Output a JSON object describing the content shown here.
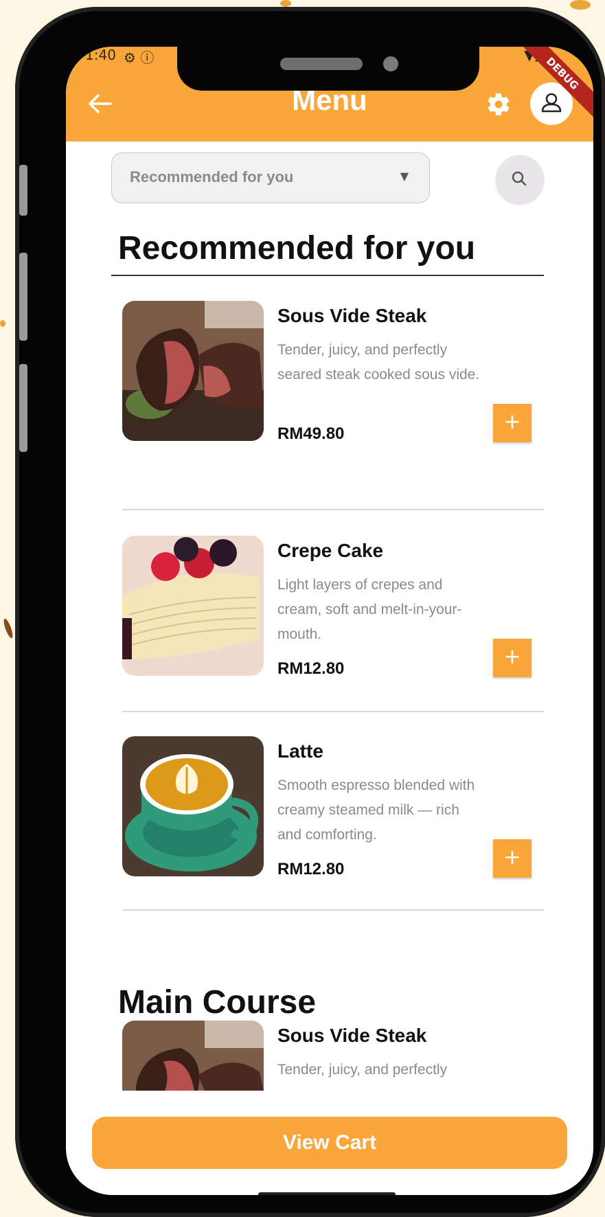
{
  "status_bar": {
    "time": "1:40",
    "icons": "⚙ ⓘ",
    "signal": "▼◢"
  },
  "app_bar": {
    "title": "Menu",
    "back_icon": "arrow-left-icon",
    "settings_icon": "gear-icon",
    "profile_icon": "user-icon",
    "debug_label": "DEBUG"
  },
  "filter": {
    "selected": "Recommended for you",
    "search_icon": "search-icon"
  },
  "sections": [
    {
      "title": "Recommended for you",
      "items": [
        {
          "name": "Sous Vide Steak",
          "description": "Tender, juicy, and perfectly seared steak cooked sous vide.",
          "price": "RM49.80",
          "add_label": "+"
        },
        {
          "name": "Crepe Cake",
          "description": "Light layers of crepes and cream, soft and melt-in-your-mouth.",
          "price": "RM12.80",
          "add_label": "+"
        },
        {
          "name": "Latte",
          "description": "Smooth espresso blended with creamy steamed milk — rich and comforting.",
          "price": "RM12.80",
          "add_label": "+"
        }
      ]
    },
    {
      "title": "Main Course",
      "items": [
        {
          "name": "Sous Vide Steak",
          "description": "Tender, juicy, and perfectly"
        }
      ]
    }
  ],
  "cart_button": {
    "label": "View Cart"
  },
  "colors": {
    "accent": "#f9a63b",
    "background": "#fdf6e3"
  }
}
